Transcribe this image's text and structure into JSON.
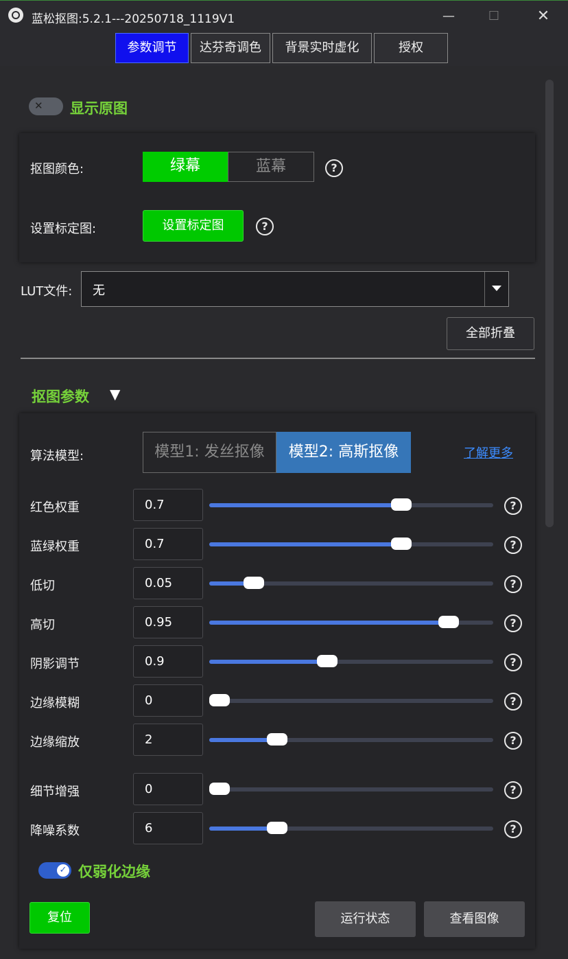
{
  "window": {
    "title": "蓝松抠图:5.2.1---20250718_1119V1",
    "minimize_glyph": "—",
    "maximize_glyph": "☐",
    "close_glyph": "✕"
  },
  "tabs": [
    {
      "label": "参数调节",
      "active": true
    },
    {
      "label": "达芬奇调色",
      "active": false
    },
    {
      "label": "背景实时虚化",
      "active": false
    },
    {
      "label": "授权",
      "active": false
    }
  ],
  "show_original": {
    "label": "显示原图",
    "enabled": false,
    "glyph": "✕"
  },
  "keying_color": {
    "label": "抠图颜色:",
    "options": [
      "绿幕",
      "蓝幕"
    ],
    "selected": "绿幕"
  },
  "calibration": {
    "label": "设置标定图:",
    "button": "设置标定图"
  },
  "help_glyph": "?",
  "lut": {
    "label": "LUT文件:",
    "value": "无"
  },
  "collapse_all": "全部折叠",
  "section": {
    "title": "抠图参数",
    "arrow": "▼"
  },
  "algorithm": {
    "label": "算法模型:",
    "options": [
      "模型1: 发丝抠像",
      "模型2: 高斯抠像"
    ],
    "selected": "模型2: 高斯抠像",
    "learn_more": "了解更多"
  },
  "params": [
    {
      "label": "红色权重",
      "value": "0.7",
      "fraction": 0.69
    },
    {
      "label": "蓝绿权重",
      "value": "0.7",
      "fraction": 0.69
    },
    {
      "label": "低切",
      "value": "0.05",
      "fraction": 0.13
    },
    {
      "label": "高切",
      "value": "0.95",
      "fraction": 0.87
    },
    {
      "label": "阴影调节",
      "value": "0.9",
      "fraction": 0.41
    },
    {
      "label": "边缘模糊",
      "value": "0",
      "fraction": 0.0
    },
    {
      "label": "边缘缩放",
      "value": "2",
      "fraction": 0.22
    },
    {
      "label": "细节增强",
      "value": "0",
      "fraction": 0.0
    },
    {
      "label": "降噪系数",
      "value": "6",
      "fraction": 0.22
    }
  ],
  "edge_only": {
    "label": "仅弱化边缘",
    "enabled": true,
    "glyph": "✓"
  },
  "buttons": {
    "reset": "复位",
    "run_status": "运行状态",
    "view_image": "查看图像"
  },
  "colors": {
    "accent_green": "#00cc00",
    "title_green": "#76d23a",
    "active_tab": "#1010ee",
    "slider_fill": "#4a78e0",
    "selected_model": "#3676b8"
  }
}
